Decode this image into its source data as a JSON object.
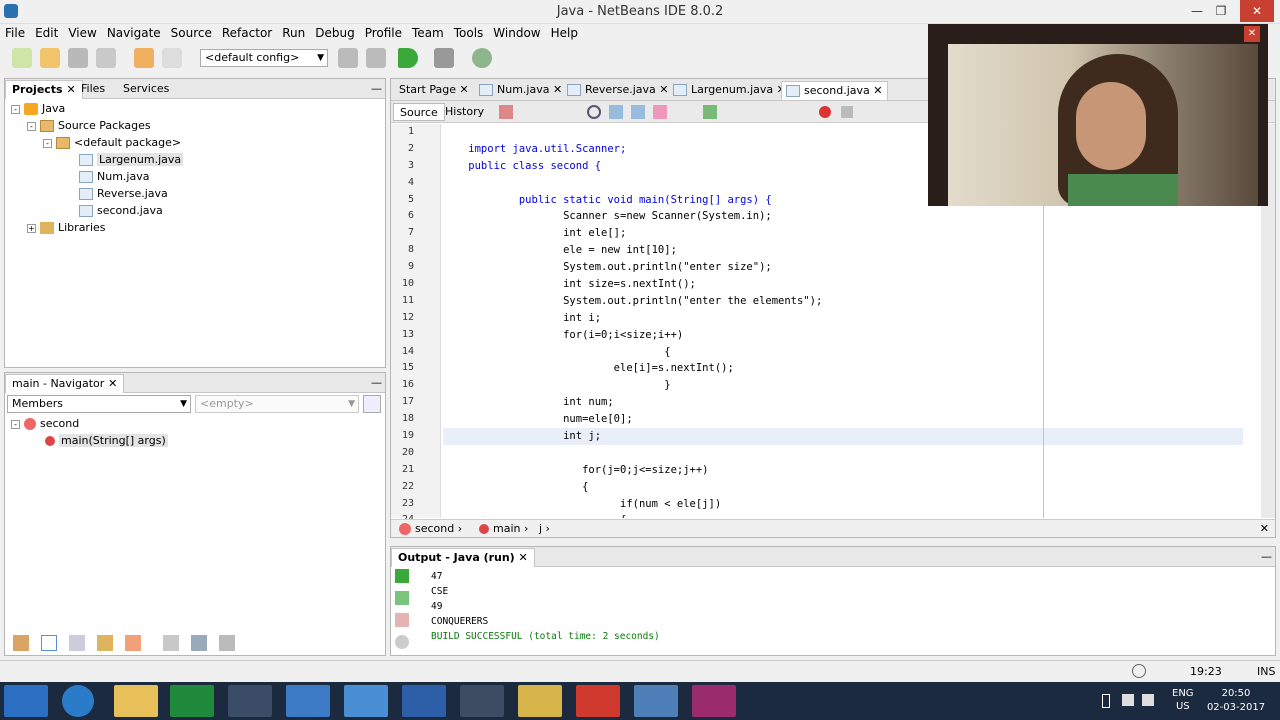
{
  "window": {
    "title": "Java - NetBeans IDE 8.0.2"
  },
  "menu": [
    "File",
    "Edit",
    "View",
    "Navigate",
    "Source",
    "Refactor",
    "Run",
    "Debug",
    "Profile",
    "Team",
    "Tools",
    "Window",
    "Help"
  ],
  "toolbar": {
    "config_value": "<default config>"
  },
  "projects": {
    "tabs": [
      "Projects",
      "Files",
      "Services"
    ],
    "tree": {
      "root": "Java",
      "source_packages": "Source Packages",
      "default_package": "<default package>",
      "files": [
        "Largenum.java",
        "Num.java",
        "Reverse.java",
        "second.java"
      ],
      "libraries": "Libraries"
    }
  },
  "navigator": {
    "title": "main - Navigator",
    "members_label": "Members",
    "filter_placeholder": "<empty>",
    "class_name": "second",
    "method": "main(String[] args)"
  },
  "editor": {
    "tabs": [
      "Start Page",
      "Num.java",
      "Reverse.java",
      "Largenum.java",
      "second.java"
    ],
    "source_label": "Source",
    "history_label": "History",
    "line_numbers": [
      "1",
      "2",
      "3",
      "4",
      "5",
      "6",
      "7",
      "8",
      "9",
      "10",
      "11",
      "12",
      "13",
      "14",
      "15",
      "16",
      "17",
      "18",
      "19",
      "20",
      "21",
      "22",
      "23",
      "24"
    ],
    "lines": [
      "",
      "    import java.util.Scanner;",
      "    public class second {",
      "",
      "            public static void main(String[] args) {",
      "                   Scanner s=new Scanner(System.in);",
      "                   int ele[];",
      "                   ele = new int[10];",
      "                   System.out.println(\"enter size\");",
      "                   int size=s.nextInt();",
      "                   System.out.println(\"enter the elements\");",
      "                   int i;",
      "                   for(i=0;i<size;i++)",
      "                                   {",
      "                           ele[i]=s.nextInt();",
      "                                   }",
      "                   int num;",
      "                   num=ele[0];",
      "                   int j;",
      "",
      "                      for(j=0;j<=size;j++)",
      "                      {",
      "                            if(num < ele[j])",
      "                            {"
    ],
    "breadcrumb": [
      "second",
      "main",
      "j"
    ]
  },
  "output": {
    "title": "Output - Java (run)",
    "lines": [
      "47",
      "CSE",
      "49",
      "CONQUERERS"
    ],
    "build": "BUILD SUCCESSFUL (total time: 2 seconds)"
  },
  "status": {
    "position": "19:23",
    "mode": "INS"
  },
  "taskbar": {
    "lang": "ENG",
    "region": "US",
    "time": "20:50",
    "date": "02-03-2017"
  },
  "colors": {
    "keyword": "#0000e6",
    "string": "#ce7b00",
    "highlight": "#fbf3b4",
    "caret_line": "#e9eff8",
    "taskbar": "#1b2a3f"
  }
}
